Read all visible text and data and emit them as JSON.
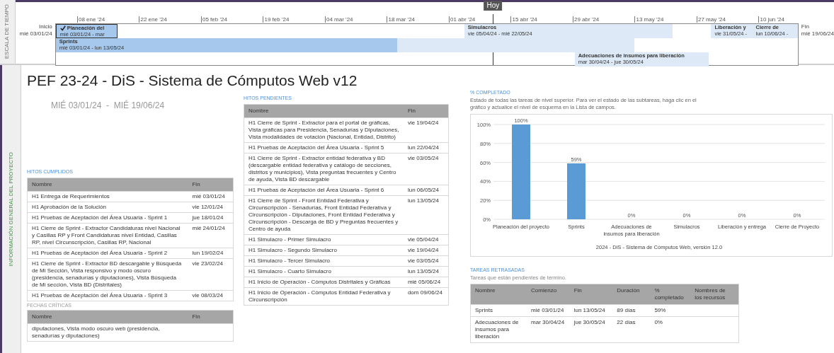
{
  "timeline": {
    "label": "ESCALA DE TIEMPO",
    "today": "Hoy",
    "start": {
      "label": "Inicio",
      "date": "mié 03/01/24"
    },
    "end": {
      "label": "Fin",
      "date": "mié 19/06/24"
    },
    "ticks": [
      "08 ene '24",
      "22 ene '24",
      "05 feb '24",
      "19 feb '24",
      "04 mar '24",
      "18 mar '24",
      "01 abr '24",
      "15 abr '24",
      "29 abr '24",
      "13 may '24",
      "27 may '24",
      "10 jun '24"
    ],
    "bars": [
      {
        "name": "Planeación del",
        "dates": "mié 03/01/24 - mar",
        "level": 1,
        "completed": true
      },
      {
        "name": "Sprints",
        "dates": "mié 03/01/24 - lun 13/05/24",
        "level": 0.59,
        "completed": false
      },
      {
        "name": "Simulacros",
        "dates": "vie 05/04/24 - mié 22/05/24",
        "level": 0,
        "completed": false
      },
      {
        "name": "Adecuaciones de insumos para liberación",
        "dates": "mar 30/04/24 - jue 30/05/24",
        "level": 0,
        "completed": false
      },
      {
        "name": "Liberación y",
        "dates": "vie 31/05/24 -",
        "level": 0,
        "completed": false
      },
      {
        "name": "Cierre de",
        "dates": "lun 10/06/24 -",
        "level": 0,
        "completed": false
      }
    ]
  },
  "section_label": "INFORMACIÓN GENERAL DEL PROYECTO",
  "title": "PEF 23-24 - DiS - Sistema de Cómputos Web v12",
  "date_range": "MIÉ 03/01/24  -  MIÉ 19/06/24",
  "hitos_cumplidos": {
    "heading": "HITOS CUMPLIDOS",
    "columns": [
      "Nombre",
      "Fin"
    ],
    "rows": [
      [
        "H1 Entrega de Requerimientos",
        "mié 03/01/24"
      ],
      [
        "H1 Aprobación de la Solución",
        "vie 12/01/24"
      ],
      [
        "H1 Pruebas de Aceptación del Área Usuaria - Sprint 1",
        "jue 18/01/24"
      ],
      [
        "H1 Cierre de Sprint - Extractor Candidaturas nivel Nacional y Casillas RP y Front Candidaturas nivel Entidad, Casillas RP, nivel Circunscripción, Casillas RP, Nacional",
        "mié 24/01/24"
      ],
      [
        "H1 Pruebas de Aceptación del Área Usuaria - Sprint 2",
        "lun 19/02/24"
      ],
      [
        "H1 Cierre de Sprint - Extractor BD descargable y Búsqueda de Mi Sección, Vista responsivo y modo oscuro (presidencia, senadurías y diputaciones), Vista Búsqueda de Mi sección, Vista BD (Distritales)",
        "vie 23/02/24"
      ],
      [
        "H1 Pruebas de Aceptación del Área Usuaria - Sprint 3",
        "vie 08/03/24"
      ]
    ]
  },
  "fechas_criticas": {
    "heading": "FECHAS CRÍTICAS",
    "columns": [
      "Nombre",
      "Fin"
    ],
    "rows": [
      [
        "diputaciones, Vista modo oscuro web (presidencia, senadurías y diputaciones)",
        ""
      ]
    ]
  },
  "hitos_pendientes": {
    "heading": "HITOS PENDIENTES",
    "columns": [
      "Nombre",
      "Fin"
    ],
    "rows": [
      [
        "H1 Cierre de Sprint - Extractor para el portal de gráficas, Vista gráficas para Presidencia, Senadurías y Diputaciones, Vista modalidades de votación (Nacional, Entidad, Distrito)",
        "vie 19/04/24"
      ],
      [
        "H1 Pruebas de Aceptación del Área Usuaria - Sprint 5",
        "lun 22/04/24"
      ],
      [
        "H1 Cierre de Sprint - Extractor entidad federativa y BD (descargable entidad federativa y catálogo de secciones, distritos y municipios), Vista preguntas frecuentes y Centro de ayuda, Vista BD descargable",
        "vie 03/05/24"
      ],
      [
        "H1 Pruebas de Aceptación del Área Usuaria - Sprint 6",
        "lun 06/05/24"
      ],
      [
        "H1 Cierre de Sprint - Front Entidad Federativa y Circunscripción - Senadurías, Front Entidad Federativa y Circunscripción - Diputaciones, Front Entidad Federativa y Circunscripción - Descarga de BD y Preguntas frecuentes y Centro de ayuda",
        "lun 13/05/24"
      ],
      [
        "H1 Simulacro - Primer Simulacro",
        "vie 05/04/24"
      ],
      [
        "H1 Simulacro - Segundo Simulacro",
        "vie 19/04/24"
      ],
      [
        "H1 Simulacro - Tercer Simulacro",
        "vie 03/05/24"
      ],
      [
        "H1 Simulacro - Cuarto Simulacro",
        "lun 13/05/24"
      ],
      [
        "H1 Inicio de Operación - Cómputos Distritales y Gráficas",
        "mié 05/06/24"
      ],
      [
        "H1 Inicio de Operación - Cómputos Entidad Federativa y Circunscripción",
        "dom 09/06/24"
      ]
    ]
  },
  "completado": {
    "heading": "% COMPLETADO",
    "description": "Estado de todas las tareas de nivel superior. Para ver el estado de las subtareas, haga clic en el gráfico y actualice el nivel de esquema en la Lista de campos.",
    "chart_data": {
      "type": "bar",
      "xlabel": "2024 - DiS - Sistema de Cómputos Web, versión 12.0",
      "categories": [
        "Planeación del proyecto",
        "Sprints",
        "Adecuaciones de insumos para liberación",
        "Simulacros",
        "Liberación y entrega",
        "Cierre de Proyecto"
      ],
      "series": [
        {
          "color": "#5b9bd5",
          "values": [
            100,
            59,
            0,
            0,
            0,
            0
          ]
        }
      ],
      "grid": true,
      "ylim": [
        0,
        100
      ],
      "yticks": [
        {
          "value": 0,
          "label": "0%"
        },
        {
          "value": 20,
          "label": "20%"
        },
        {
          "value": 40,
          "label": "40%"
        },
        {
          "value": 60,
          "label": "60%"
        },
        {
          "value": 80,
          "label": "80%"
        },
        {
          "value": 100,
          "label": "100%"
        }
      ],
      "value_labels": [
        "100%",
        "59%",
        "0%",
        "0%",
        "0%",
        "0%"
      ]
    }
  },
  "tareas_retrasadas": {
    "heading": "TAREAS RETRASADAS",
    "description": "Tareas que están pendientes de término.",
    "columns": [
      "Nombre",
      "Comienzo",
      "Fin",
      "Duración",
      "% completado",
      "Nombres de los recursos"
    ],
    "rows": [
      [
        "Sprints",
        "mié 03/01/24",
        "lun 13/05/24",
        "89 días",
        "59%",
        ""
      ],
      [
        "Adecuaciones de insumos para liberación",
        "mar 30/04/24",
        "jue 30/05/24",
        "22 días",
        "0%",
        ""
      ]
    ]
  }
}
